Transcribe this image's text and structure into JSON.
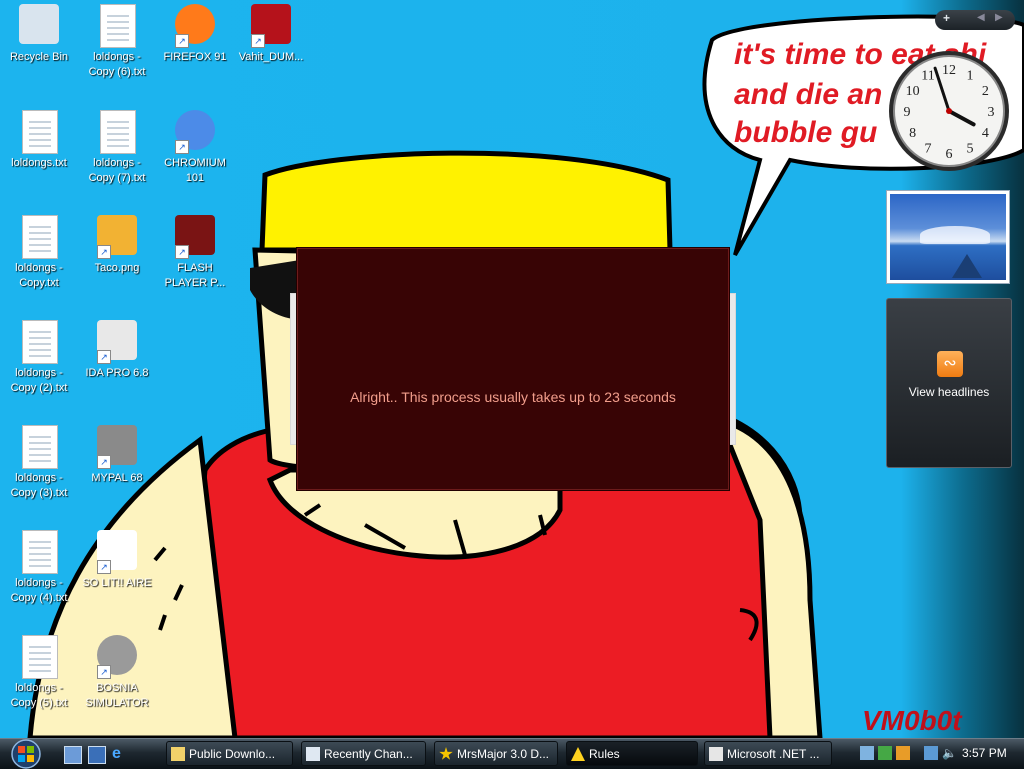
{
  "wallpaper": {
    "speech_lines": [
      "it's time to eat shi",
      "and die an",
      "bubble gu"
    ],
    "signature": "VM0b0t",
    "colors": {
      "sky": "#1cb4ee",
      "hair": "#fff200",
      "skin": "#fdf3bf",
      "shirt": "#ec1c24",
      "speech": "#e01b24"
    }
  },
  "desktop_icons": [
    {
      "label": "Recycle Bin",
      "icon": "recycle-bin-icon"
    },
    {
      "label": "loldongs - Copy (6).txt",
      "icon": "text-file-icon"
    },
    {
      "label": "FIREFOX 91",
      "icon": "firefox-icon"
    },
    {
      "label": "Vahit_DUM...",
      "icon": "matryoshka-icon"
    },
    {
      "label": "loldongs.txt",
      "icon": "text-file-icon"
    },
    {
      "label": "loldongs - Copy (7).txt",
      "icon": "text-file-icon"
    },
    {
      "label": "CHROMIUM 101",
      "icon": "chromium-icon"
    },
    {
      "label": "loldongs - Copy.txt",
      "icon": "text-file-icon"
    },
    {
      "label": "Taco.png",
      "icon": "taco-image-icon"
    },
    {
      "label": "FLASH PLAYER P...",
      "icon": "flash-player-icon"
    },
    {
      "label": "loldongs - Copy (2).txt",
      "icon": "text-file-icon"
    },
    {
      "label": "IDA PRO 6.8",
      "icon": "ida-pro-icon"
    },
    {
      "label": "loldongs - Copy (3).txt",
      "icon": "text-file-icon"
    },
    {
      "label": "MYPAL 68",
      "icon": "raccoon-icon"
    },
    {
      "label": "loldongs - Copy (4).txt",
      "icon": "text-file-icon"
    },
    {
      "label": "SO LIT!! AIRE",
      "icon": "solitaire-icon"
    },
    {
      "label": "loldongs - Copy (5).txt",
      "icon": "text-file-icon"
    },
    {
      "label": "BOSNIA SIMULATOR",
      "icon": "mine-icon"
    }
  ],
  "gadgets": {
    "toolbar_add": "+",
    "clock": {
      "hour": 3,
      "minute": 57,
      "numbers": [
        "12",
        "1",
        "2",
        "3",
        "4",
        "5",
        "6",
        "7",
        "8",
        "9",
        "10",
        "11"
      ]
    },
    "feed": {
      "label": "View headlines"
    }
  },
  "dialog": {
    "message": "Alright.. This process usually takes up to 23 seconds",
    "background": "#380405",
    "text_color": "#f29e8c"
  },
  "taskbar": {
    "tasks": [
      {
        "label": "Public Downlo...",
        "icon": "folder-icon"
      },
      {
        "label": "Recently Chan...",
        "icon": "document-icon"
      },
      {
        "label": "MrsMajor 3.0 D...",
        "icon": "star-icon"
      },
      {
        "label": "Rules",
        "icon": "warning-icon",
        "active": true
      },
      {
        "label": "Microsoft .NET ...",
        "icon": "dotnet-icon"
      }
    ],
    "time": "3:57 PM"
  }
}
